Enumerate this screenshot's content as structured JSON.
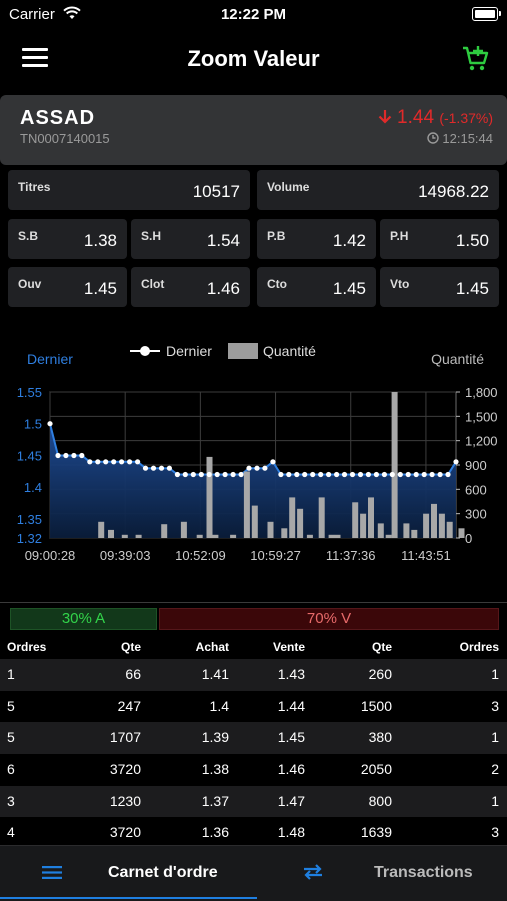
{
  "status": {
    "carrier": "Carrier",
    "time": "12:22 PM"
  },
  "header": {
    "title": "Zoom Valeur"
  },
  "stock": {
    "symbol": "ASSAD",
    "isin": "TN0007140015",
    "price": "1.44",
    "change": "(-1.37%)",
    "time": "12:15:44",
    "down_color": "#e02a2a"
  },
  "tiles": {
    "titres": {
      "label": "Titres",
      "value": "10517"
    },
    "volume": {
      "label": "Volume",
      "value": "14968.22"
    },
    "sb": {
      "label": "S.B",
      "value": "1.38"
    },
    "sh": {
      "label": "S.H",
      "value": "1.54"
    },
    "pb": {
      "label": "P.B",
      "value": "1.42"
    },
    "ph": {
      "label": "P.H",
      "value": "1.50"
    },
    "ouv": {
      "label": "Ouv",
      "value": "1.45"
    },
    "clot": {
      "label": "Clot",
      "value": "1.46"
    },
    "cto": {
      "label": "Cto",
      "value": "1.45"
    },
    "vto": {
      "label": "Vto",
      "value": "1.45"
    }
  },
  "chart_data": {
    "type": "line",
    "left_axis_label": "Dernier",
    "right_axis_label": "Quantité",
    "legend": [
      "Dernier",
      "Quantité"
    ],
    "y_left_ticks": [
      "1.55",
      "1.5",
      "1.45",
      "1.4",
      "1.35",
      "1.32"
    ],
    "y_left_lim": [
      1.32,
      1.55
    ],
    "y_right_ticks": [
      "1,800",
      "1,500",
      "1,200",
      "900",
      "600",
      "300",
      "0"
    ],
    "y_right_lim": [
      0,
      1800
    ],
    "x_ticks": [
      "09:00:28",
      "09:39:03",
      "10:52:09",
      "10:59:27",
      "11:37:36",
      "11:43:51"
    ],
    "series": [
      {
        "name": "Dernier",
        "values": [
          1.5,
          1.45,
          1.45,
          1.45,
          1.45,
          1.44,
          1.44,
          1.44,
          1.44,
          1.44,
          1.44,
          1.44,
          1.43,
          1.43,
          1.43,
          1.43,
          1.42,
          1.42,
          1.42,
          1.42,
          1.42,
          1.42,
          1.42,
          1.42,
          1.42,
          1.43,
          1.43,
          1.43,
          1.44,
          1.42,
          1.42,
          1.42,
          1.42,
          1.42,
          1.42,
          1.42,
          1.42,
          1.42,
          1.42,
          1.42,
          1.42,
          1.42,
          1.42,
          1.42,
          1.42,
          1.42,
          1.42,
          1.42,
          1.42,
          1.42,
          1.42,
          1.44
        ]
      },
      {
        "name": "Quantité",
        "values": [
          0,
          0,
          0,
          0,
          200,
          100,
          0,
          40,
          0,
          0,
          0,
          0,
          170,
          0,
          200,
          0,
          1000,
          0,
          0,
          0,
          820,
          0,
          400,
          0,
          0,
          0,
          300,
          0,
          0,
          0,
          500,
          0,
          360,
          0,
          0,
          0,
          0,
          0,
          500,
          0,
          0,
          0,
          300,
          0,
          0,
          0,
          1800,
          0,
          0,
          0,
          200,
          0,
          0,
          0,
          120,
          0,
          300,
          0,
          0,
          0,
          0,
          0,
          0,
          0,
          0,
          0,
          0,
          0,
          0,
          0,
          0,
          0,
          0,
          0,
          0,
          0,
          0,
          0,
          0,
          0,
          0,
          0,
          0,
          0,
          0,
          0,
          0,
          0,
          0,
          0,
          0,
          0,
          0,
          0,
          0,
          0,
          0,
          0,
          0,
          0,
          0,
          0,
          0,
          0,
          0,
          0,
          0,
          0,
          0,
          0,
          0,
          0,
          0,
          0,
          0,
          0,
          0,
          0,
          0,
          0,
          0,
          0,
          0,
          0,
          0,
          0,
          0,
          0,
          0,
          0,
          0,
          0,
          0,
          0,
          0,
          0,
          0,
          0,
          0,
          0,
          0,
          0,
          0,
          0,
          0,
          0,
          0,
          0
        ]
      }
    ],
    "bars": [
      {
        "x": 0.13,
        "v": 200
      },
      {
        "x": 0.155,
        "v": 100
      },
      {
        "x": 0.19,
        "v": 40
      },
      {
        "x": 0.225,
        "v": 40
      },
      {
        "x": 0.29,
        "v": 170
      },
      {
        "x": 0.34,
        "v": 200
      },
      {
        "x": 0.38,
        "v": 40
      },
      {
        "x": 0.405,
        "v": 1000
      },
      {
        "x": 0.42,
        "v": 40
      },
      {
        "x": 0.465,
        "v": 40
      },
      {
        "x": 0.5,
        "v": 820
      },
      {
        "x": 0.52,
        "v": 400
      },
      {
        "x": 0.56,
        "v": 200
      },
      {
        "x": 0.595,
        "v": 120
      },
      {
        "x": 0.615,
        "v": 500
      },
      {
        "x": 0.635,
        "v": 360
      },
      {
        "x": 0.66,
        "v": 40
      },
      {
        "x": 0.69,
        "v": 500
      },
      {
        "x": 0.715,
        "v": 40
      },
      {
        "x": 0.73,
        "v": 40
      },
      {
        "x": 0.775,
        "v": 440
      },
      {
        "x": 0.795,
        "v": 300
      },
      {
        "x": 0.815,
        "v": 500
      },
      {
        "x": 0.84,
        "v": 180
      },
      {
        "x": 0.86,
        "v": 40
      },
      {
        "x": 0.875,
        "v": 1800
      },
      {
        "x": 0.905,
        "v": 180
      },
      {
        "x": 0.925,
        "v": 100
      },
      {
        "x": 0.955,
        "v": 300
      },
      {
        "x": 0.975,
        "v": 420
      },
      {
        "x": 0.995,
        "v": 300
      },
      {
        "x": 1.015,
        "v": 200
      },
      {
        "x": 1.045,
        "v": 120
      }
    ]
  },
  "ratio": {
    "buy": "30% A",
    "sell": "70% V"
  },
  "book": {
    "headers": [
      "Ordres",
      "Qte",
      "Achat",
      "Vente",
      "Qte",
      "Ordres"
    ],
    "rows": [
      [
        "1",
        "66",
        "1.41",
        "1.43",
        "260",
        "1"
      ],
      [
        "5",
        "247",
        "1.4",
        "1.44",
        "1500",
        "3"
      ],
      [
        "5",
        "1707",
        "1.39",
        "1.45",
        "380",
        "1"
      ],
      [
        "6",
        "3720",
        "1.38",
        "1.46",
        "2050",
        "2"
      ],
      [
        "3",
        "1230",
        "1.37",
        "1.47",
        "800",
        "1"
      ],
      [
        "4",
        "3720",
        "1.36",
        "1.48",
        "1639",
        "3"
      ]
    ]
  },
  "tabs": {
    "order_book": "Carnet d'ordre",
    "transactions": "Transactions",
    "accent": "#1f7fe0"
  }
}
